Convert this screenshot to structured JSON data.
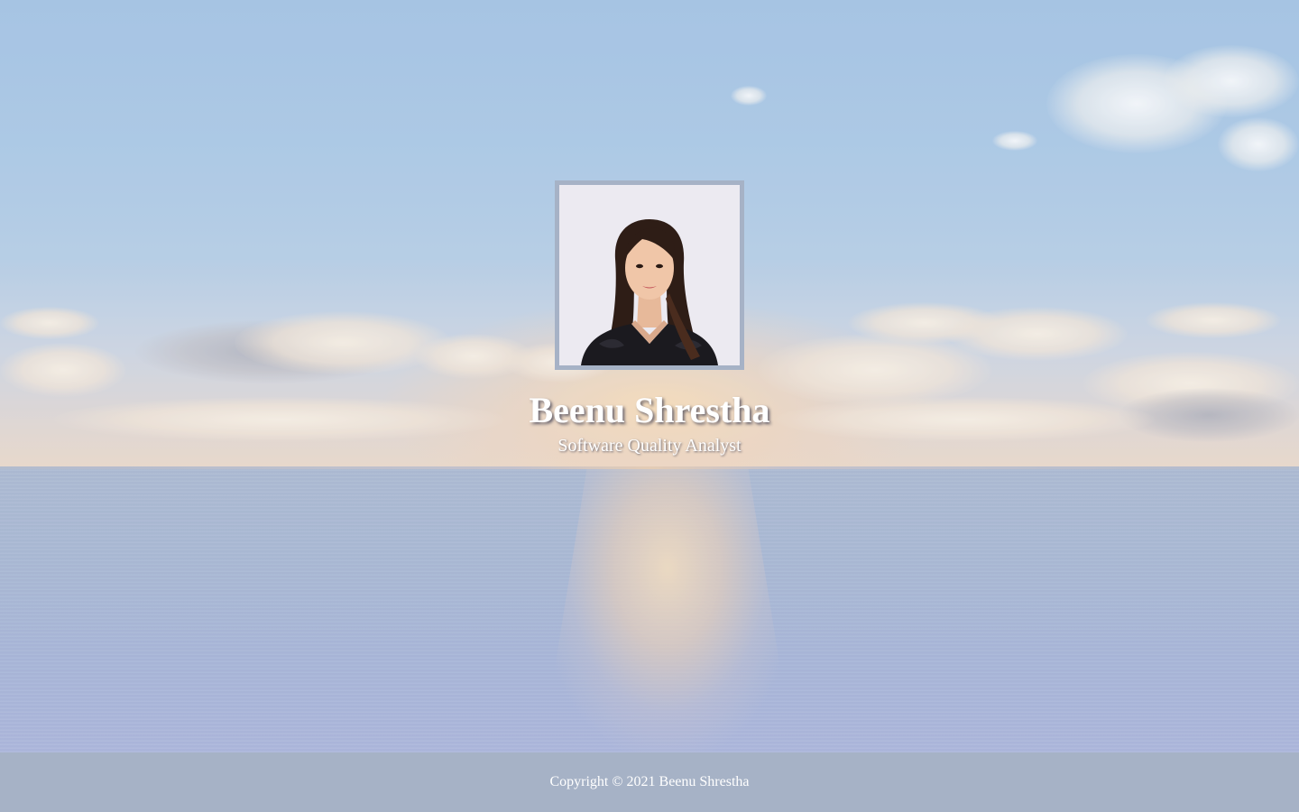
{
  "hero": {
    "background_image": "ocean-sunset-scene",
    "colors": {
      "sky": "#a7c7e6",
      "sea": "#a3b3d1",
      "sun_glow": "#f6dcba"
    }
  },
  "profile": {
    "photo": "profile-photo",
    "name": "Beenu Shrestha",
    "title": "Software Quality Analyst",
    "frame_color": "#a6b2c6"
  },
  "footer": {
    "copyright": "Copyright © 2021 Beenu Shrestha",
    "background": "#a6b2c6"
  }
}
